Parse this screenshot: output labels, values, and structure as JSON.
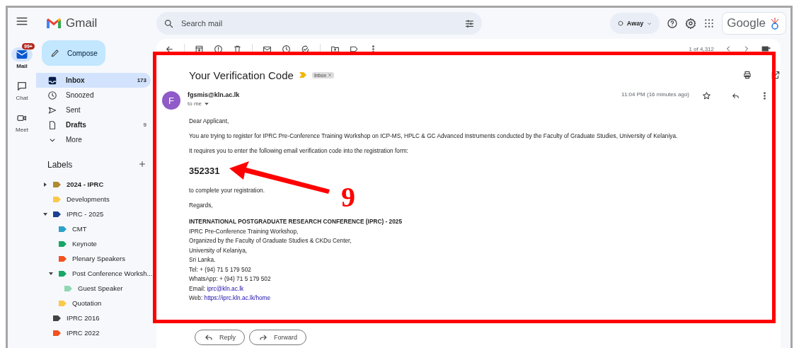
{
  "rail": [
    {
      "label": "Mail",
      "kind": "mail",
      "selected": true,
      "badge": "99+"
    },
    {
      "label": "Chat",
      "kind": "chat",
      "selected": false
    },
    {
      "label": "Meet",
      "kind": "meet",
      "selected": false
    }
  ],
  "brand": "Gmail",
  "compose": "Compose",
  "search": {
    "placeholder": "Search mail"
  },
  "status": "Away",
  "account": "Google",
  "nav": [
    {
      "label": "Inbox",
      "kind": "inbox",
      "count": "173",
      "selected": true,
      "bold": true
    },
    {
      "label": "Snoozed",
      "kind": "snoozed",
      "selected": false,
      "bold": false
    },
    {
      "label": "Sent",
      "kind": "sent",
      "selected": false,
      "bold": false
    },
    {
      "label": "Drafts",
      "kind": "drafts",
      "count": "9",
      "selected": false,
      "bold": true
    },
    {
      "label": "More",
      "kind": "more",
      "selected": false,
      "bold": false
    }
  ],
  "labels": {
    "title": "Labels",
    "items": [
      {
        "label": "2024 - IPRC",
        "color": "#b08a2e",
        "bold": true,
        "expanded": false
      },
      {
        "label": "Developments",
        "color": "#fbc94a",
        "bold": false
      },
      {
        "label": "IPRC - 2025",
        "color": "#1c3f94",
        "bold": false,
        "expanded": true,
        "children": [
          {
            "label": "CMT",
            "color": "#2da2c8",
            "bold": false
          },
          {
            "label": "Keynote",
            "color": "#16a765",
            "bold": false
          },
          {
            "label": "Plenary Speakers",
            "color": "#f4511e",
            "bold": false
          },
          {
            "label": "Post Conference Worksh...",
            "color": "#16a765",
            "bold": false,
            "expanded": true,
            "children": [
              {
                "label": "Guest Speaker",
                "color": "#8fd8b2",
                "bold": false
              }
            ]
          },
          {
            "label": "Quotation",
            "color": "#fbc94a",
            "bold": false
          }
        ]
      },
      {
        "label": "IPRC 2016",
        "color": "#434343",
        "bold": false
      },
      {
        "label": "IPRC 2022",
        "color": "#f4511e",
        "bold": false
      }
    ]
  },
  "toolbar": {
    "position": "1 of 4,312"
  },
  "message": {
    "subject": "Your Verification Code",
    "chip": "Inbox",
    "avatar": "F",
    "sender": "fgsmis@kln.ac.lk",
    "recipient": "to me",
    "time": "11:04 PM (16 minutes ago)",
    "body": [
      {
        "kind": "text",
        "text": "Dear Applicant,"
      },
      {
        "kind": "text",
        "text": "You are trying to register for IPRC Pre-Conference Training Workshop on ICP-MS, HPLC & GC Advanced Instruments conducted by the Faculty of Graduate Studies, University of Kelaniya."
      },
      {
        "kind": "text",
        "text": "It requires you to enter the following email verification code into the registration form:"
      },
      {
        "kind": "code",
        "text": "352331"
      },
      {
        "kind": "text",
        "text": "to complete your registration."
      },
      {
        "kind": "text",
        "text": "Regards,"
      }
    ],
    "signature": [
      {
        "kind": "heading",
        "text": "INTERNATIONAL POSTGRADUATE RESEARCH CONFERENCE (IPRC) - 2025"
      },
      {
        "kind": "line",
        "text": "IPRC Pre-Conference Training Workshop,"
      },
      {
        "kind": "line",
        "text": "Organized by the Faculty of Graduate Studies & CKDu Center,"
      },
      {
        "kind": "line",
        "text": "University of Kelaniya,"
      },
      {
        "kind": "line",
        "text": "Sri Lanka."
      },
      {
        "kind": "line",
        "text": "Tel: + (94) 71 5 179 502"
      },
      {
        "kind": "line",
        "text": "WhatsApp: + (94) 71 5 179 502"
      },
      {
        "kind": "link",
        "text": "Email:",
        "link": "iprc@kln.ac.lk"
      },
      {
        "kind": "link",
        "text": "Web:",
        "link": "https://iprc.kln.ac.lk/home"
      }
    ]
  },
  "actions": [
    {
      "label": "Reply",
      "kind": "reply"
    },
    {
      "label": "Forward",
      "kind": "forward"
    }
  ],
  "annotation": {
    "number": "9"
  }
}
